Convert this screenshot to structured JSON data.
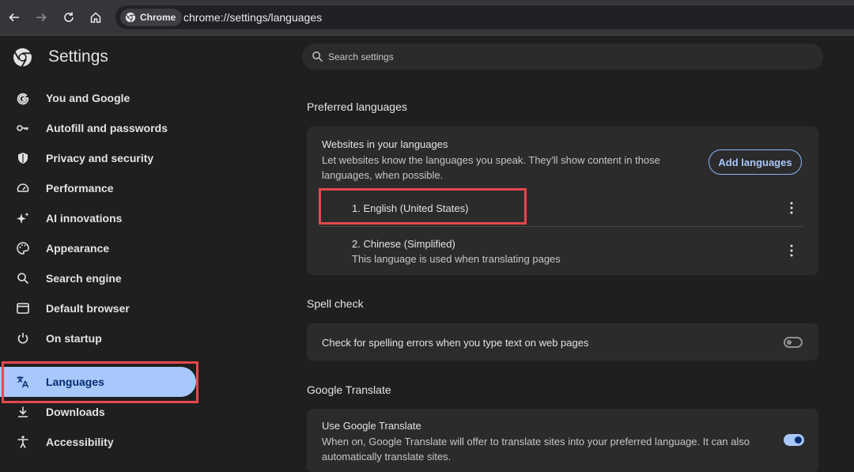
{
  "browser": {
    "chip_label": "Chrome",
    "url": "chrome://settings/languages"
  },
  "sidebar": {
    "title": "Settings",
    "items": [
      {
        "label": "You and Google",
        "icon": "google-g-icon"
      },
      {
        "label": "Autofill and passwords",
        "icon": "key-icon"
      },
      {
        "label": "Privacy and security",
        "icon": "shield-icon"
      },
      {
        "label": "Performance",
        "icon": "speedometer-icon"
      },
      {
        "label": "AI innovations",
        "icon": "sparkle-icon"
      },
      {
        "label": "Appearance",
        "icon": "palette-icon"
      },
      {
        "label": "Search engine",
        "icon": "search-icon"
      },
      {
        "label": "Default browser",
        "icon": "browser-window-icon"
      },
      {
        "label": "On startup",
        "icon": "power-icon"
      },
      {
        "label": "Languages",
        "icon": "translate-icon",
        "active": true
      },
      {
        "label": "Downloads",
        "icon": "download-icon"
      },
      {
        "label": "Accessibility",
        "icon": "accessibility-icon"
      }
    ]
  },
  "search": {
    "placeholder": "Search settings"
  },
  "preferred": {
    "section_title": "Preferred languages",
    "heading": "Websites in your languages",
    "description": "Let websites know the languages you speak. They'll show content in those languages, when possible.",
    "add_button": "Add languages",
    "languages": [
      {
        "name": "1. English (United States)",
        "note": ""
      },
      {
        "name": "2. Chinese (Simplified)",
        "note": "This language is used when translating pages"
      }
    ]
  },
  "spell": {
    "section_title": "Spell check",
    "label": "Check for spelling errors when you type text on web pages",
    "enabled": false
  },
  "translate": {
    "section_title": "Google Translate",
    "heading": "Use Google Translate",
    "description": "When on, Google Translate will offer to translate sites into your preferred language. It can also automatically translate sites.",
    "enabled": true
  },
  "colors": {
    "accent": "#a8c7fa",
    "highlight": "#e5484d"
  }
}
